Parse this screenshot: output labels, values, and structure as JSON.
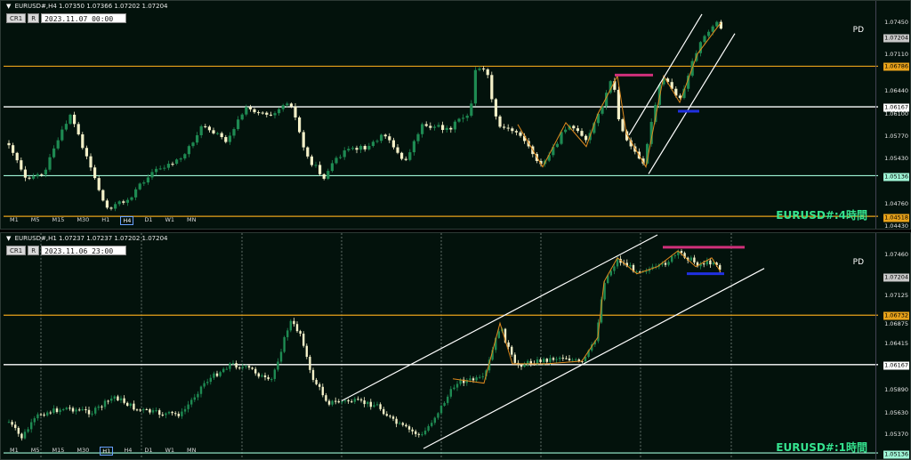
{
  "panels": [
    {
      "symbol_info": "EURUSD#,H4  1.07350 1.07366 1.07202 1.07204",
      "crosshair_btn": "CR1",
      "r_btn": "R",
      "datetime": "2023.11.07 00:00",
      "pd_label": "PD",
      "chart_label": "EURUSD#:4時間",
      "timeframes": [
        "M1",
        "M5",
        "M15",
        "M30",
        "H1",
        "H4",
        "D1",
        "W1",
        "MN"
      ],
      "active_timeframe": "H4",
      "axis_ticks": [
        "1.07450",
        "1.07110",
        "1.06440",
        "1.06100",
        "1.05770",
        "1.05430",
        "1.04760",
        "1.04430"
      ],
      "price_tags": [
        {
          "text": "1.07204",
          "color": "#c8c8c8"
        },
        {
          "text": "1.06786",
          "color": "#e8a21a"
        },
        {
          "text": "1.06167",
          "color": "#ffffff"
        },
        {
          "text": "1.05136",
          "color": "#9ff5d6"
        },
        {
          "text": "1.04518",
          "color": "#e8a21a"
        }
      ]
    },
    {
      "symbol_info": "EURUSD#,H1  1.07237 1.07237 1.07202 1.07204",
      "crosshair_btn": "CR1",
      "r_btn": "R",
      "datetime": "2023.11.06 23:00",
      "pd_label": "PD",
      "chart_label": "EURUSD#:1時間",
      "timeframes": [
        "M1",
        "M5",
        "M15",
        "M30",
        "H1",
        "H4",
        "D1",
        "W1",
        "MN"
      ],
      "active_timeframe": "H1",
      "axis_ticks": [
        "1.07460",
        "1.07125",
        "1.06875",
        "1.06415",
        "1.05890",
        "1.05630",
        "1.05370"
      ],
      "price_tags": [
        {
          "text": "1.07204",
          "color": "#c8c8c8"
        },
        {
          "text": "1.06732",
          "color": "#e8a21a"
        },
        {
          "text": "1.06167",
          "color": "#ffffff"
        },
        {
          "text": "1.05136",
          "color": "#9ff5d6"
        }
      ]
    }
  ],
  "colors": {
    "background": "#03120c",
    "bull_candle": "#1e8a52",
    "bear_candle": "#f3f0c8",
    "resistance": "#e8a21a",
    "support": "#ffffff",
    "support_low": "#9ff5d6",
    "zigzag": "#e08a1e",
    "magenta_level": "#d0307a",
    "blue_level": "#2030e0"
  }
}
